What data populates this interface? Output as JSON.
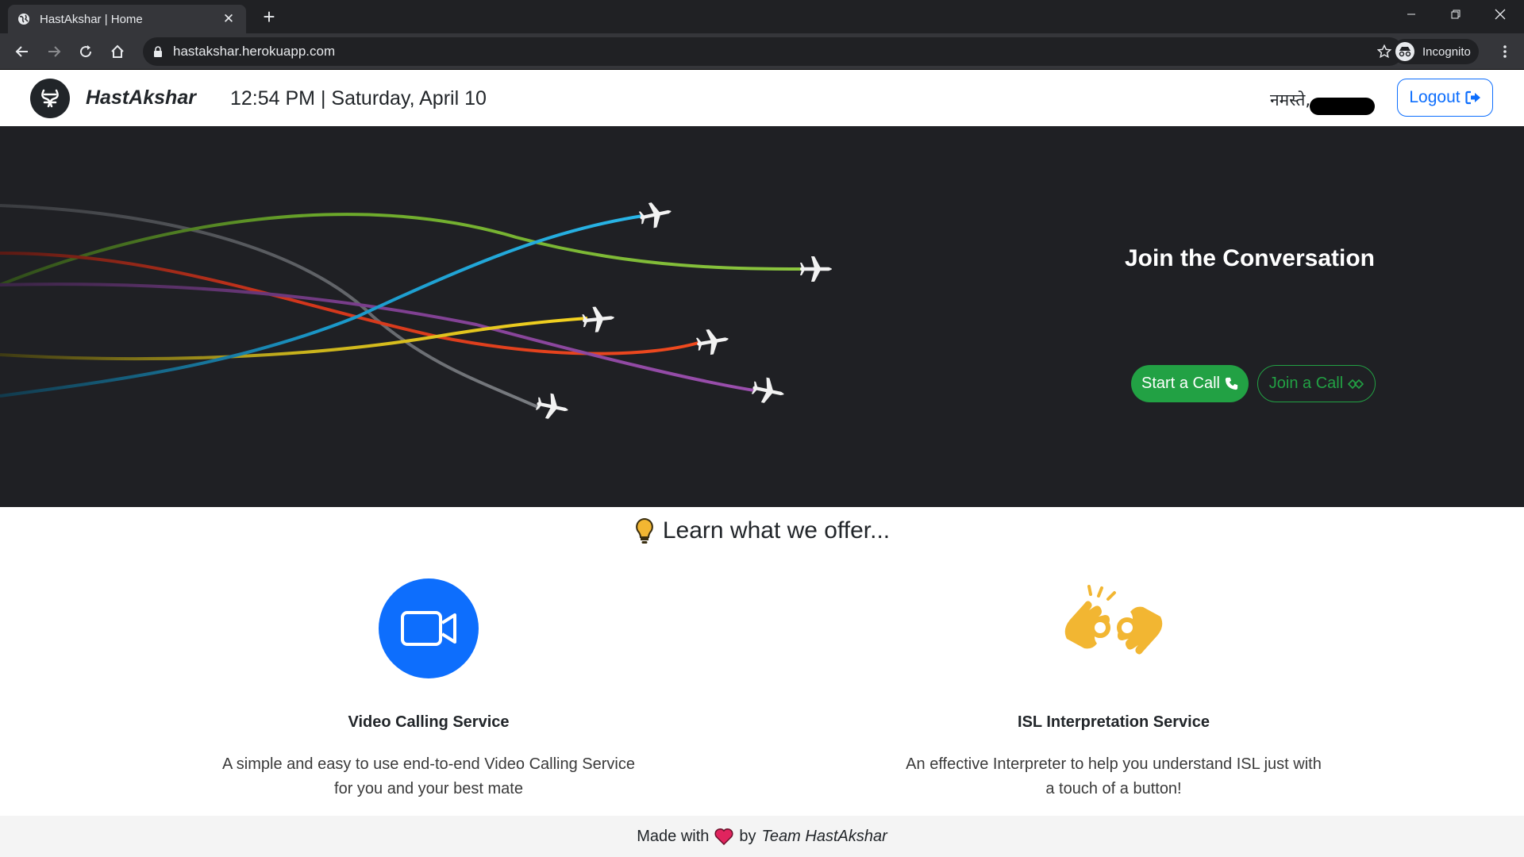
{
  "browser": {
    "tab_title": "HastAkshar | Home",
    "url": "hastakshar.herokuapp.com",
    "profile_label": "Incognito"
  },
  "navbar": {
    "brand": "HastAkshar",
    "clock": "12:54 PM | Saturday, April 10",
    "greeting": "नमस्ते,",
    "logout_label": "Logout"
  },
  "hero": {
    "title": "Join the Conversation",
    "start_call_label": "Start a Call",
    "join_call_label": "Join a Call"
  },
  "offers": {
    "heading": "Learn what we offer...",
    "features": [
      {
        "icon": "video-camera-icon",
        "title": "Video Calling Service",
        "description": "A simple and easy to use end-to-end Video Calling Service for you and your best mate"
      },
      {
        "icon": "sign-language-icon",
        "title": "ISL Interpretation Service",
        "description": "An effective Interpreter to help you understand ISL just with a touch of a button!"
      }
    ]
  },
  "footer": {
    "prefix": "Made with",
    "middle": "by",
    "team": "Team HastAkshar"
  },
  "colors": {
    "primary": "#0d6efd",
    "success": "#22a144",
    "hero_bg": "#1f2024",
    "bulb": "#f2b632",
    "hands": "#f2b632",
    "heart": "#e0245e"
  }
}
